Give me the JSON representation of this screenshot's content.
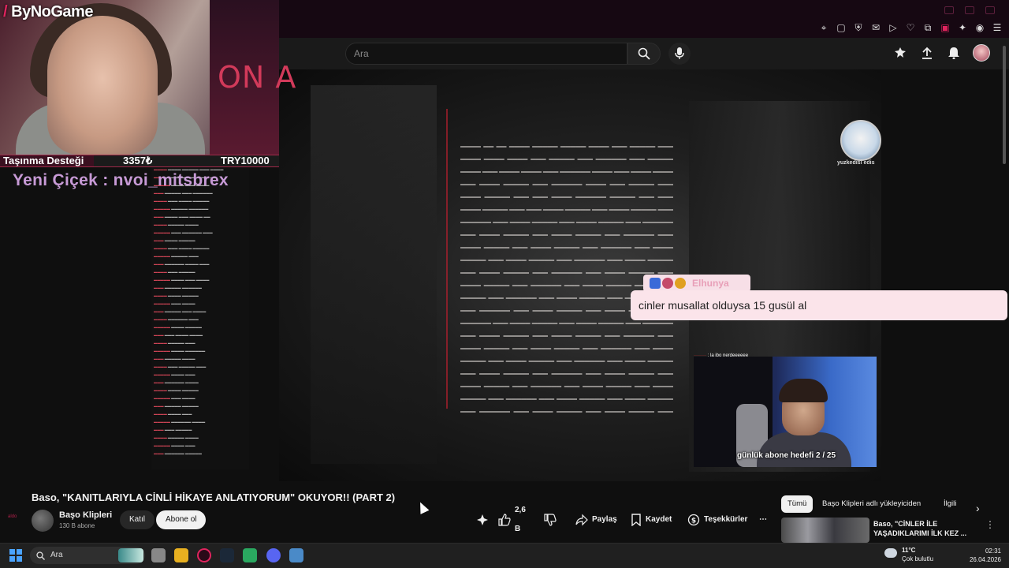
{
  "stream": {
    "brand": "ByNoGame",
    "support_label": "Taşınma Desteği",
    "support_current": "3357₺",
    "support_target": "TRY10000",
    "support_progress": 0.3357,
    "donor_text": "Yeni Çiçek : nvoi_mitsbrex",
    "poster_text": "ON A"
  },
  "youtube": {
    "search_placeholder": "Ara",
    "video_title": "Baso, \"KANITLARIYLA CİNLİ HİKAYE ANLATIYORUM\" OKUYOR!! (PART 2)",
    "channel_name": "Başo Klipleri",
    "channel_subs": "130 B abone",
    "join_label": "Katıl",
    "subscribe_label": "Abone ol",
    "like_count": "2,6 B",
    "share_label": "Paylaş",
    "save_label": "Kaydet",
    "thanks_label": "Teşekkürler",
    "more_label": "⋯",
    "chips": [
      "Tümü",
      "Başo Klipleri adlı yükleyiciden",
      "İlgili"
    ],
    "related_title": "Baso, \"CİNLER İLE YAŞADIKLARIMI İLK KEZ ..."
  },
  "overlay": {
    "cat_name": "yuzkedisi edis",
    "alert_name": "Elhunya",
    "alert_message": "cinler musallat olduysa 15 gusül al",
    "chat_name_line_user": "········",
    "chat_name_line_text": ": la ibo nerdeeeeee",
    "sub_goal": "günlük abone hedefi 2 / 25",
    "edge_tag": "aldo"
  },
  "taskbar": {
    "search_label": "Ara",
    "weather_temp": "11°C",
    "weather_desc": "Çok bulutlu",
    "time": "02:31",
    "date": "26.04.2026"
  },
  "colors": {
    "brand_accent": "#e0245e",
    "youtube_bg": "#0f0f0f",
    "alert_bg": "#fbe4ea",
    "donor_text": "#c79ad6"
  }
}
